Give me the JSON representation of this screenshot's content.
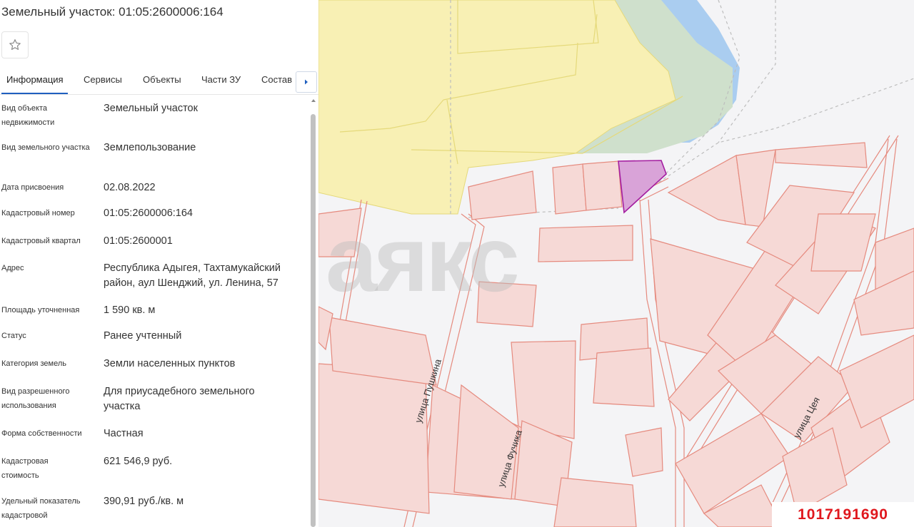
{
  "header": {
    "title": "Земельный участок: 01:05:2600006:164"
  },
  "favorite": {
    "icon": "star-outline-icon"
  },
  "tabs": [
    {
      "label": "Информация",
      "active": true
    },
    {
      "label": "Сервисы"
    },
    {
      "label": "Объекты"
    },
    {
      "label": "Части ЗУ"
    },
    {
      "label": "Состав"
    }
  ],
  "tab_next_icon": "chevron-right-icon",
  "properties": [
    {
      "label": "Вид объекта недвижимости",
      "value": "Земельный участок"
    },
    {
      "label": "Вид земельного участка",
      "value": "Землепользование"
    },
    {
      "label": "Дата присвоения",
      "value": "02.08.2022"
    },
    {
      "label": "Кадастровый номер",
      "value": "01:05:2600006:164"
    },
    {
      "label": "Кадастровый квартал",
      "value": "01:05:2600001"
    },
    {
      "label": "Адрес",
      "value": "Республика Адыгея, Тахтамукайский район, аул Шенджий, ул. Ленина, 57"
    },
    {
      "label": "Площадь уточненная",
      "value": "1 590 кв. м"
    },
    {
      "label": "Статус",
      "value": "Ранее учтенный"
    },
    {
      "label": "Категория земель",
      "value": "Земли населенных пунктов"
    },
    {
      "label": "Вид разрешенного использования",
      "value": "Для приусадебного земельного участка"
    },
    {
      "label": "Форма собственности",
      "value": "Частная"
    },
    {
      "label": "Кадастровая стоимость",
      "value": "621 546,9 руб."
    },
    {
      "label": "Удельный показатель кадастровой",
      "value": "390,91 руб./кв. м"
    }
  ],
  "map": {
    "streets": [
      "улица Пушкина",
      "улица Фучика",
      "улица Цея"
    ],
    "watermark": "аякс",
    "listing_id": "1017191690",
    "colors": {
      "parcel_fill": "#f6d9d6",
      "parcel_stroke": "#e58a7e",
      "selected_fill": "#d9a3d8",
      "selected_stroke": "#a41da0",
      "zone_yellow": "#f8f0b4",
      "forest": "#cfe0cc",
      "water": "#aacdf0"
    }
  }
}
